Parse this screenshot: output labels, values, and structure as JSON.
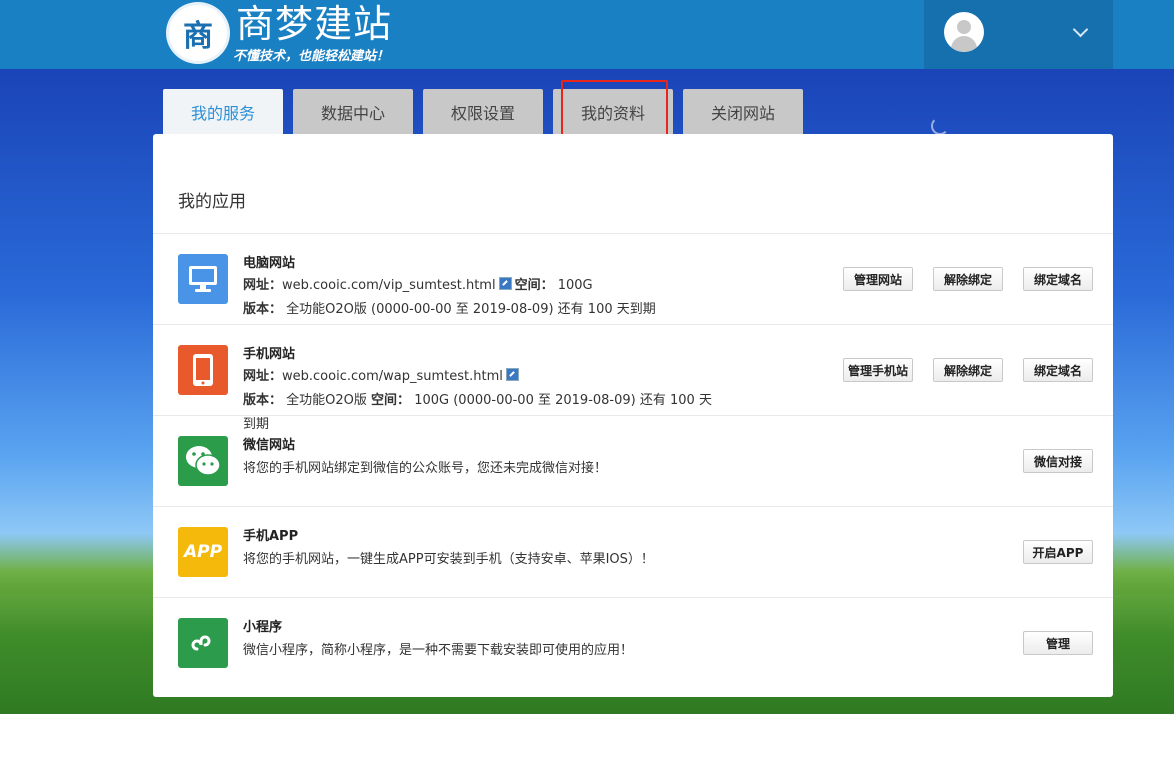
{
  "header": {
    "logo_char": "商",
    "logo_title": "商梦建站",
    "logo_slogan": "不懂技术，也能轻松建站！"
  },
  "tabs": [
    {
      "label": "我的服务",
      "active": true
    },
    {
      "label": "数据中心",
      "active": false
    },
    {
      "label": "权限设置",
      "active": false
    },
    {
      "label": "我的资料",
      "active": false,
      "highlighted": true
    },
    {
      "label": "关闭网站",
      "active": false
    }
  ],
  "panel": {
    "title": "我的应用",
    "rows": [
      {
        "title": "电脑网站",
        "icon": "monitor-icon",
        "icon_color": "#4a94e8",
        "url_label": "网址：",
        "url": "web.cooic.com/vip_sumtest.html",
        "space_label": "空间：",
        "space": "100G",
        "version_label": "版本：",
        "version": "全功能O2O版 (0000-00-00 至 2019-08-09) 还有 100 天到期",
        "buttons": [
          "管理网站",
          "解除绑定",
          "绑定域名"
        ]
      },
      {
        "title": "手机网站",
        "icon": "mobile-phone-icon",
        "icon_color": "#e85a2c",
        "url_label": "网址：",
        "url": "web.cooic.com/wap_sumtest.html",
        "version_label": "版本：",
        "version_a": "全功能O2O版",
        "space_label": "空间：",
        "space_version": "100G (0000-00-00 至 2019-08-09) 还有 100 天",
        "version_tail": "到期",
        "buttons": [
          "管理手机站",
          "解除绑定",
          "绑定域名"
        ]
      },
      {
        "title": "微信网站",
        "icon": "wechat-icon",
        "icon_color": "#2a9c4a",
        "desc": "将您的手机网站绑定到微信的公众账号，您还未完成微信对接！",
        "buttons": [
          "微信对接"
        ]
      },
      {
        "title": "手机APP",
        "icon": "app-icon",
        "icon_color": "#f5b90c",
        "icon_text": "APP",
        "desc": "将您的手机网站，一键生成APP可安装到手机（支持安卓、苹果IOS）！",
        "buttons": [
          "开启APP"
        ]
      },
      {
        "title": "小程序",
        "icon": "mini-program-icon",
        "icon_color": "#2c9c4c",
        "desc": "微信小程序，简称小程序，是一种不需要下载安装即可使用的应用！",
        "buttons": [
          "管理"
        ]
      }
    ]
  },
  "colors": {
    "header_bg": "#1a80c4",
    "active_tab_text": "#2d8fd6",
    "highlight_border": "#e8261c"
  }
}
